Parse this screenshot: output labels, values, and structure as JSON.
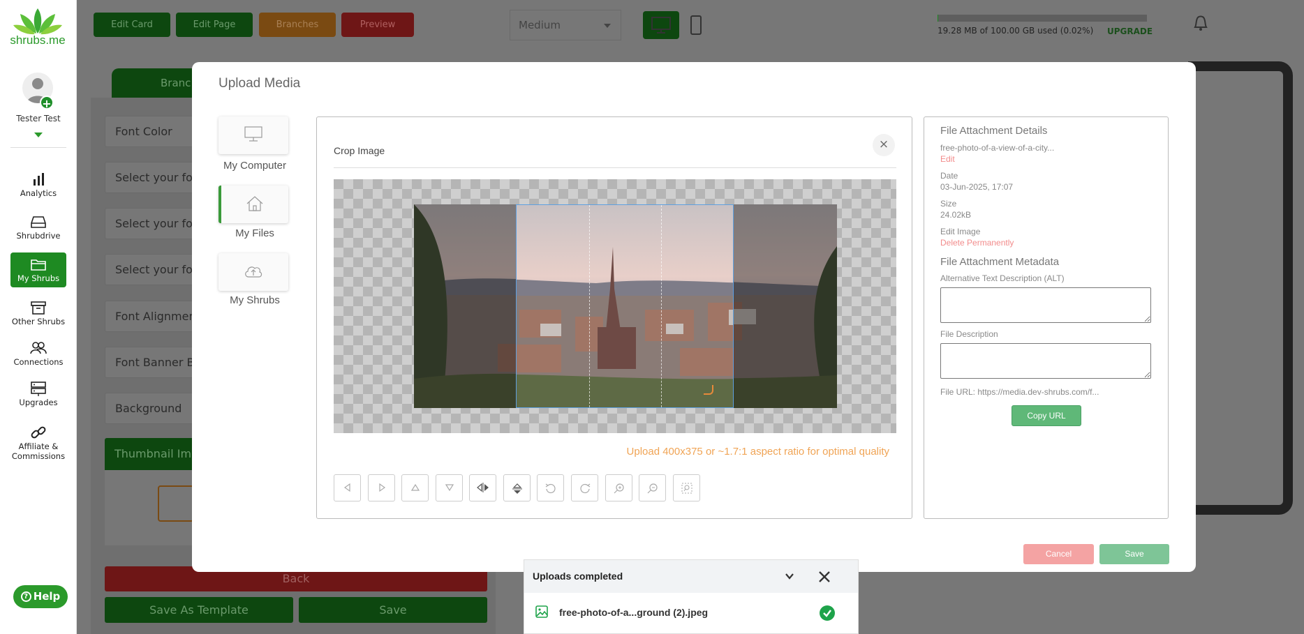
{
  "app": {
    "logo_text": "shrubs.me",
    "user_name": "Tester Test",
    "help_label": "Help"
  },
  "sidebar": {
    "items": [
      {
        "label": "Analytics",
        "icon": "bar-chart-icon",
        "active": false
      },
      {
        "label": "Shrubdrive",
        "icon": "drive-icon",
        "active": false
      },
      {
        "label": "My Shrubs",
        "icon": "folder-icon",
        "active": true
      },
      {
        "label": "Other Shrubs",
        "icon": "archive-icon",
        "active": false
      },
      {
        "label": "Connections",
        "icon": "people-icon",
        "active": false
      },
      {
        "label": "Upgrades",
        "icon": "server-icon",
        "active": false
      },
      {
        "label": "Affiliate & Commissions",
        "icon": "link-icon",
        "active": false
      }
    ]
  },
  "toolbar": {
    "edit_card": "Edit Card",
    "edit_page": "Edit Page",
    "branches": "Branches",
    "preview": "Preview",
    "size_value": "Medium",
    "storage_text": "19.28 MB of 100.00 GB used (0.02%)",
    "storage_fraction": 0.0002,
    "upgrade_label": "UPGRADE"
  },
  "editor": {
    "tab_label": "Branc",
    "rows": [
      "Font Color",
      "Select your font",
      "Select your font",
      "Select your font",
      "Font Alignment",
      "Font Banner Ba",
      "Background"
    ],
    "thumbnail_label": "Thumbnail Imag",
    "back_label": "Back",
    "save_template_label": "Save As Template",
    "save_label": "Save"
  },
  "modal": {
    "title": "Upload Media",
    "sources": [
      {
        "label": "My Computer",
        "icon": "monitor-icon",
        "active": false
      },
      {
        "label": "My Files",
        "icon": "home-icon",
        "active": true
      },
      {
        "label": "My Shrubs",
        "icon": "cloud-upload-icon",
        "active": false
      }
    ],
    "crop": {
      "title": "Crop Image",
      "close_glyph": "×",
      "aspect_note": "Upload 400x375 or ~1.7:1 aspect ratio for optimal quality",
      "tools": [
        "move-left-icon",
        "move-right-icon",
        "move-up-icon",
        "move-down-icon",
        "flip-horizontal-icon",
        "flip-vertical-icon",
        "rotate-left-icon",
        "rotate-right-icon",
        "zoom-in-icon",
        "zoom-out-icon",
        "reset-crop-icon"
      ]
    },
    "details": {
      "heading": "File Attachment Details",
      "file_name": "free-photo-of-a-view-of-a-city...",
      "edit_link": "Edit",
      "date_label": "Date",
      "date_value": "03-Jun-2025, 17:07",
      "size_label": "Size",
      "size_value": "24.02kB",
      "edit_image_label": "Edit Image",
      "delete_link": "Delete Permanently",
      "metadata_heading": "File Attachment Metadata",
      "alt_label": "Alternative Text Description (ALT)",
      "alt_value": "",
      "desc_label": "File Description",
      "desc_value": "",
      "url_text": "File URL: https://media.dev-shrubs.com/f...",
      "copy_url": "Copy URL"
    },
    "cancel_label": "Cancel",
    "save_label": "Save"
  },
  "upload_toast": {
    "title": "Uploads completed",
    "file_name": "free-photo-of-a...ground (2).jpeg",
    "status": "completed"
  },
  "colors": {
    "brand_green": "#2b9a2b",
    "active_nav": "#1e8a22",
    "accent_orange": "#f0a455",
    "link_red": "#f28b8b",
    "success_green": "#1ea34a"
  }
}
